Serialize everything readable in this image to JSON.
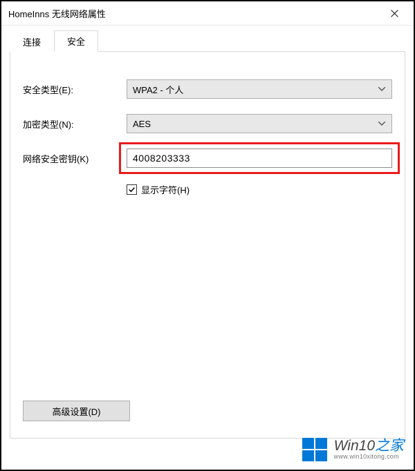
{
  "window": {
    "title": "HomeInns 无线网络属性"
  },
  "tabs": {
    "connect": "连接",
    "security": "安全"
  },
  "form": {
    "securityTypeLabel": "安全类型(E):",
    "securityTypeValue": "WPA2 - 个人",
    "encryptionTypeLabel": "加密类型(N):",
    "encryptionTypeValue": "AES",
    "securityKeyLabel": "网络安全密钥(K)",
    "securityKeyValue": "4008203333",
    "showCharsLabel": "显示字符(H)",
    "showCharsChecked": true
  },
  "buttons": {
    "advanced": "高级设置(D)"
  },
  "watermark": {
    "brand_a": "Win10",
    "brand_b": "之家",
    "url": "www.win10xitong.com"
  },
  "colors": {
    "highlight": "#ea1b1c",
    "accent": "#0078d7"
  }
}
